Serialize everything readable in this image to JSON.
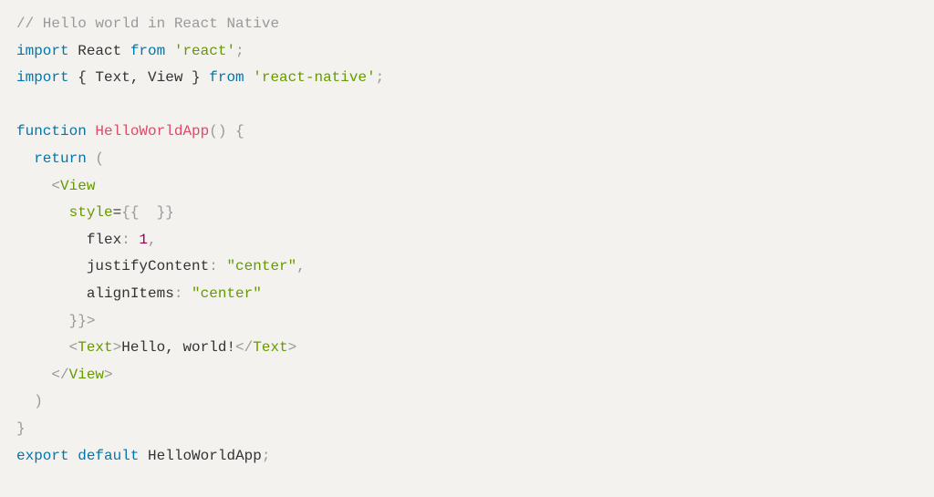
{
  "code": {
    "line1_comment": "// Hello world in React Native",
    "line2_import": "import",
    "line2_react": " React ",
    "line2_from": "from",
    "line2_space": " ",
    "line2_string": "'react'",
    "line2_semi": ";",
    "line3_import": "import",
    "line3_braces": " { Text, View } ",
    "line3_from": "from",
    "line3_space": " ",
    "line3_string": "'react-native'",
    "line3_semi": ";",
    "line5_function": "function",
    "line5_space": " ",
    "line5_name": "HelloWorldApp",
    "line5_parens": "()",
    "line5_space2": " ",
    "line5_brace": "{",
    "line6_indent": "  ",
    "line6_return": "return",
    "line6_space": " ",
    "line6_paren": "(",
    "line7_indent": "    ",
    "line7_lt": "<",
    "line7_view": "View",
    "line8_indent": "      ",
    "line8_style": "style",
    "line8_eq": "=",
    "line8_braces": "{{  }}",
    "line9_indent": "        ",
    "line9_flex": "flex",
    "line9_colon": ": ",
    "line9_num": "1",
    "line9_comma": ",",
    "line10_indent": "        ",
    "line10_jc": "justifyContent",
    "line10_colon": ": ",
    "line10_str": "\"center\"",
    "line10_comma": ",",
    "line11_indent": "        ",
    "line11_ai": "alignItems",
    "line11_colon": ": ",
    "line11_str": "\"center\"",
    "line12_indent": "      ",
    "line12_braces": "}}",
    "line12_gt": ">",
    "line13_indent": "      ",
    "line13_lt1": "<",
    "line13_text1": "Text",
    "line13_gt1": ">",
    "line13_content": "Hello, world!",
    "line13_lt2": "</",
    "line13_text2": "Text",
    "line13_gt2": ">",
    "line14_indent": "    ",
    "line14_lt": "</",
    "line14_view": "View",
    "line14_gt": ">",
    "line15_indent": "  ",
    "line15_paren": ")",
    "line16_brace": "}",
    "line17_export": "export",
    "line17_space": " ",
    "line17_default": "default",
    "line17_space2": " ",
    "line17_name": "HelloWorldApp",
    "line17_semi": ";"
  }
}
